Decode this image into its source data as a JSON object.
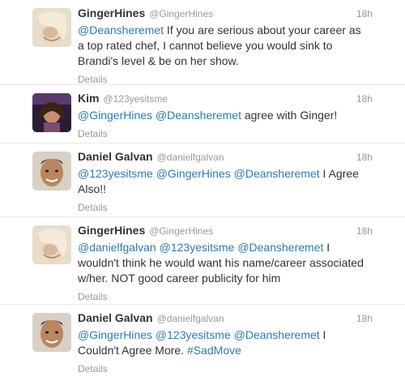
{
  "tweets": [
    {
      "fullname": "GingerHines",
      "username": "@GingerHines",
      "time": "18h",
      "avatar": "ginger-avatar",
      "text": [
        {
          "t": "mention",
          "v": "@Deansheremet"
        },
        {
          "t": "text",
          "v": " If you are serious about your career as a top rated chef, I cannot believe you would sink to Brandi's level & be on her show."
        }
      ],
      "details": "Details"
    },
    {
      "fullname": "Kim",
      "username": "@123yesitsme",
      "time": "18h",
      "avatar": "kim-avatar",
      "text": [
        {
          "t": "mention",
          "v": "@GingerHines"
        },
        {
          "t": "text",
          "v": " "
        },
        {
          "t": "mention",
          "v": "@Deansheremet"
        },
        {
          "t": "text",
          "v": " agree with Ginger!"
        }
      ],
      "details": "Details"
    },
    {
      "fullname": "Daniel Galvan",
      "username": "@danielfgalvan",
      "time": "18h",
      "avatar": "daniel-avatar",
      "text": [
        {
          "t": "mention",
          "v": "@123yesitsme"
        },
        {
          "t": "text",
          "v": " "
        },
        {
          "t": "mention",
          "v": "@GingerHines"
        },
        {
          "t": "text",
          "v": " "
        },
        {
          "t": "mention",
          "v": "@Deansheremet"
        },
        {
          "t": "text",
          "v": " I Agree Also!!"
        }
      ],
      "details": "Details"
    },
    {
      "fullname": "GingerHines",
      "username": "@GingerHines",
      "time": "18h",
      "avatar": "ginger-avatar",
      "text": [
        {
          "t": "mention",
          "v": "@danielfgalvan"
        },
        {
          "t": "text",
          "v": " "
        },
        {
          "t": "mention",
          "v": "@123yesitsme"
        },
        {
          "t": "text",
          "v": " "
        },
        {
          "t": "mention",
          "v": "@Deansheremet"
        },
        {
          "t": "text",
          "v": " I wouldn't think he would want his name/career associated w/her. NOT good career publicity for him"
        }
      ],
      "details": "Details"
    },
    {
      "fullname": "Daniel Galvan",
      "username": "@danielfgalvan",
      "time": "18h",
      "avatar": "daniel-avatar",
      "text": [
        {
          "t": "mention",
          "v": "@GingerHines"
        },
        {
          "t": "text",
          "v": " "
        },
        {
          "t": "mention",
          "v": "@123yesitsme"
        },
        {
          "t": "text",
          "v": " "
        },
        {
          "t": "mention",
          "v": "@Deansheremet"
        },
        {
          "t": "text",
          "v": " I Couldn't Agree More. "
        },
        {
          "t": "hashtag",
          "v": "#SadMove"
        }
      ],
      "details": "Details"
    }
  ]
}
